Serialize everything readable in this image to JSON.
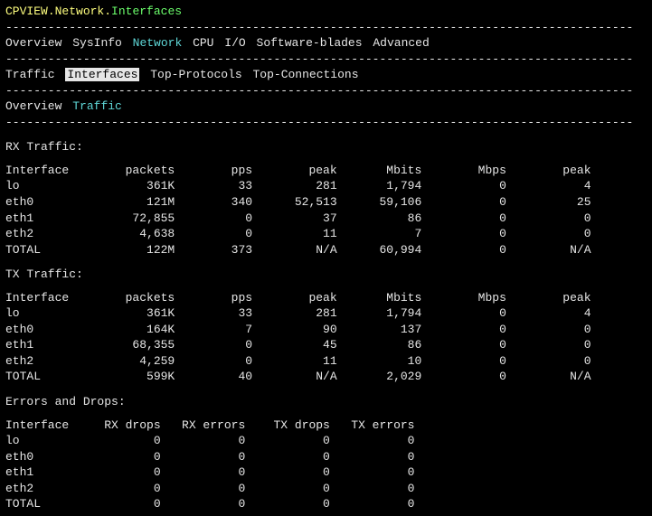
{
  "title": {
    "a": "CPVIEW",
    "b": "Network",
    "c": "Interfaces"
  },
  "menu_top": [
    "Overview",
    "SysInfo",
    "Network",
    "CPU",
    "I/O",
    "Software-blades",
    "Advanced"
  ],
  "menu_top_active_idx": 2,
  "menu_sub": [
    "Traffic",
    "Interfaces",
    "Top-Protocols",
    "Top-Connections"
  ],
  "menu_sub_selected_idx": 1,
  "menu_third": [
    "Overview",
    "Traffic"
  ],
  "menu_third_active_idx": 1,
  "sections": {
    "rx": {
      "title": "RX Traffic:",
      "cols": [
        "Interface",
        "packets",
        "pps",
        "peak",
        "Mbits",
        "Mbps",
        "peak"
      ],
      "rows": [
        [
          "lo",
          "361K",
          "33",
          "281",
          "1,794",
          "0",
          "4"
        ],
        [
          "eth0",
          "121M",
          "340",
          "52,513",
          "59,106",
          "0",
          "25"
        ],
        [
          "eth1",
          "72,855",
          "0",
          "37",
          "86",
          "0",
          "0"
        ],
        [
          "eth2",
          "4,638",
          "0",
          "11",
          "7",
          "0",
          "0"
        ],
        [
          "TOTAL",
          "122M",
          "373",
          "N/A",
          "60,994",
          "0",
          "N/A"
        ]
      ]
    },
    "tx": {
      "title": "TX Traffic:",
      "cols": [
        "Interface",
        "packets",
        "pps",
        "peak",
        "Mbits",
        "Mbps",
        "peak"
      ],
      "rows": [
        [
          "lo",
          "361K",
          "33",
          "281",
          "1,794",
          "0",
          "4"
        ],
        [
          "eth0",
          "164K",
          "7",
          "90",
          "137",
          "0",
          "0"
        ],
        [
          "eth1",
          "68,355",
          "0",
          "45",
          "86",
          "0",
          "0"
        ],
        [
          "eth2",
          "4,259",
          "0",
          "11",
          "10",
          "0",
          "0"
        ],
        [
          "TOTAL",
          "599K",
          "40",
          "N/A",
          "2,029",
          "0",
          "N/A"
        ]
      ]
    },
    "err": {
      "title": "Errors and Drops:",
      "cols": [
        "Interface",
        "RX drops",
        "RX errors",
        "TX drops",
        "TX errors"
      ],
      "rows": [
        [
          "lo",
          "0",
          "0",
          "0",
          "0"
        ],
        [
          "eth0",
          "0",
          "0",
          "0",
          "0"
        ],
        [
          "eth1",
          "0",
          "0",
          "0",
          "0"
        ],
        [
          "eth2",
          "0",
          "0",
          "0",
          "0"
        ],
        [
          "TOTAL",
          "0",
          "0",
          "0",
          "0"
        ]
      ]
    }
  }
}
